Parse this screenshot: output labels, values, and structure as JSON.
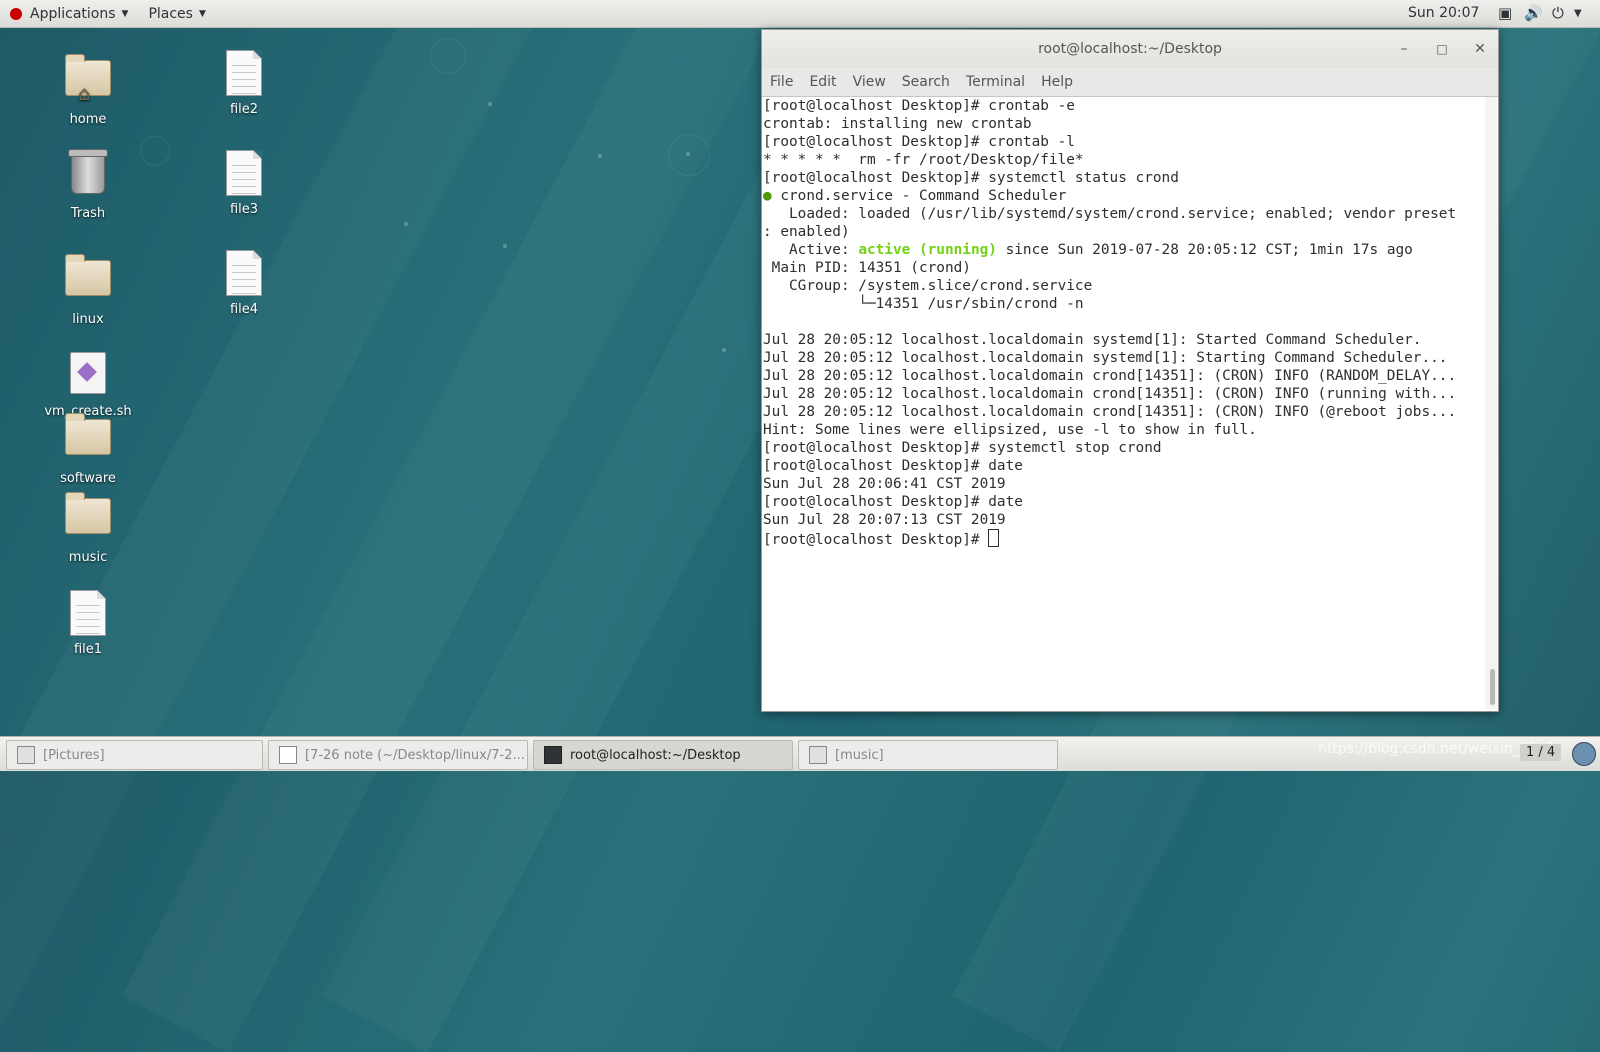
{
  "topbar": {
    "applications_label": "Applications",
    "places_label": "Places",
    "clock": "Sun 20:07"
  },
  "desktop": {
    "icons": {
      "home": "home",
      "trash": "Trash",
      "linux": "linux",
      "vm_create": "vm_create.sh",
      "software": "software",
      "music": "music",
      "file1": "file1",
      "file2": "file2",
      "file3": "file3",
      "file4": "file4"
    }
  },
  "terminal": {
    "title": "root@localhost:~/Desktop",
    "menu": [
      "File",
      "Edit",
      "View",
      "Search",
      "Terminal",
      "Help"
    ],
    "lines": {
      "l0": "[root@localhost Desktop]# crontab -e",
      "l1": "crontab: installing new crontab",
      "l2": "[root@localhost Desktop]# crontab -l",
      "l3": "* * * * *  rm -fr /root/Desktop/file*",
      "l4": "[root@localhost Desktop]# systemctl status crond",
      "l5_dot": "●",
      "l5": " crond.service - Command Scheduler",
      "l6": "   Loaded: loaded (/usr/lib/systemd/system/crond.service; enabled; vendor preset",
      "l7": ": enabled)",
      "l8_pre": "   Active: ",
      "l8_status": "active (running)",
      "l8_post": " since Sun 2019-07-28 20:05:12 CST; 1min 17s ago",
      "l9": " Main PID: 14351 (crond)",
      "l10": "   CGroup: /system.slice/crond.service",
      "l11": "           └─14351 /usr/sbin/crond -n",
      "l12": "",
      "l13": "Jul 28 20:05:12 localhost.localdomain systemd[1]: Started Command Scheduler.",
      "l14": "Jul 28 20:05:12 localhost.localdomain systemd[1]: Starting Command Scheduler...",
      "l15": "Jul 28 20:05:12 localhost.localdomain crond[14351]: (CRON) INFO (RANDOM_DELAY...",
      "l16": "Jul 28 20:05:12 localhost.localdomain crond[14351]: (CRON) INFO (running with...",
      "l17": "Jul 28 20:05:12 localhost.localdomain crond[14351]: (CRON) INFO (@reboot jobs...",
      "l18": "Hint: Some lines were ellipsized, use -l to show in full.",
      "l19": "[root@localhost Desktop]# systemctl stop crond",
      "l20": "[root@localhost Desktop]# date",
      "l21": "Sun Jul 28 20:06:41 CST 2019",
      "l22": "[root@localhost Desktop]# date",
      "l23": "Sun Jul 28 20:07:13 CST 2019",
      "l24": "[root@localhost Desktop]# "
    }
  },
  "taskbar": {
    "tasks": [
      "[Pictures]",
      "[7-26 note (~/Desktop/linux/7-2...",
      "root@localhost:~/Desktop",
      "[music]"
    ],
    "watermark": "https://blog.csdn.net/weixin_4[...]",
    "pager": "1 / 4"
  },
  "colors": {
    "desktop_bg": "#27707a",
    "status_green": "#73d216",
    "bullet_green": "#4e9a06"
  }
}
